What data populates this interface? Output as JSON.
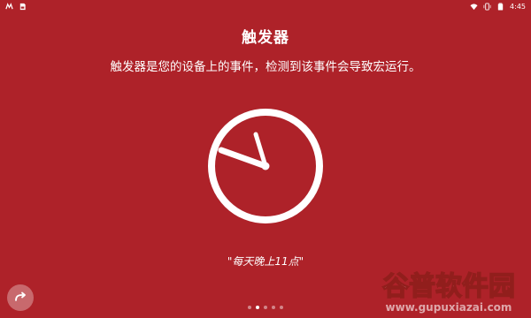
{
  "status_bar": {
    "left_icons": [
      "m-logo-icon",
      "sd-card-icon"
    ],
    "right_icons": [
      "wifi-icon",
      "vibrate-icon",
      "battery-icon"
    ],
    "time": "4:45"
  },
  "screen": {
    "title": "触发器",
    "description": "触发器是您的设备上的事件，检测到该事件会导致宏运行。",
    "illustration_icon": "clock-icon",
    "example": "\"每天晚上11点\""
  },
  "navigation": {
    "next_button_icon": "redo-arrow-icon",
    "pages": [
      {
        "active": false
      },
      {
        "active": true
      },
      {
        "active": false
      },
      {
        "active": false
      },
      {
        "active": false
      }
    ]
  },
  "watermark": {
    "brand": "谷普软件园",
    "url": "www.gupuxiazai.com"
  },
  "colors": {
    "background": "#AE2229",
    "foreground": "#FFFFFF"
  }
}
